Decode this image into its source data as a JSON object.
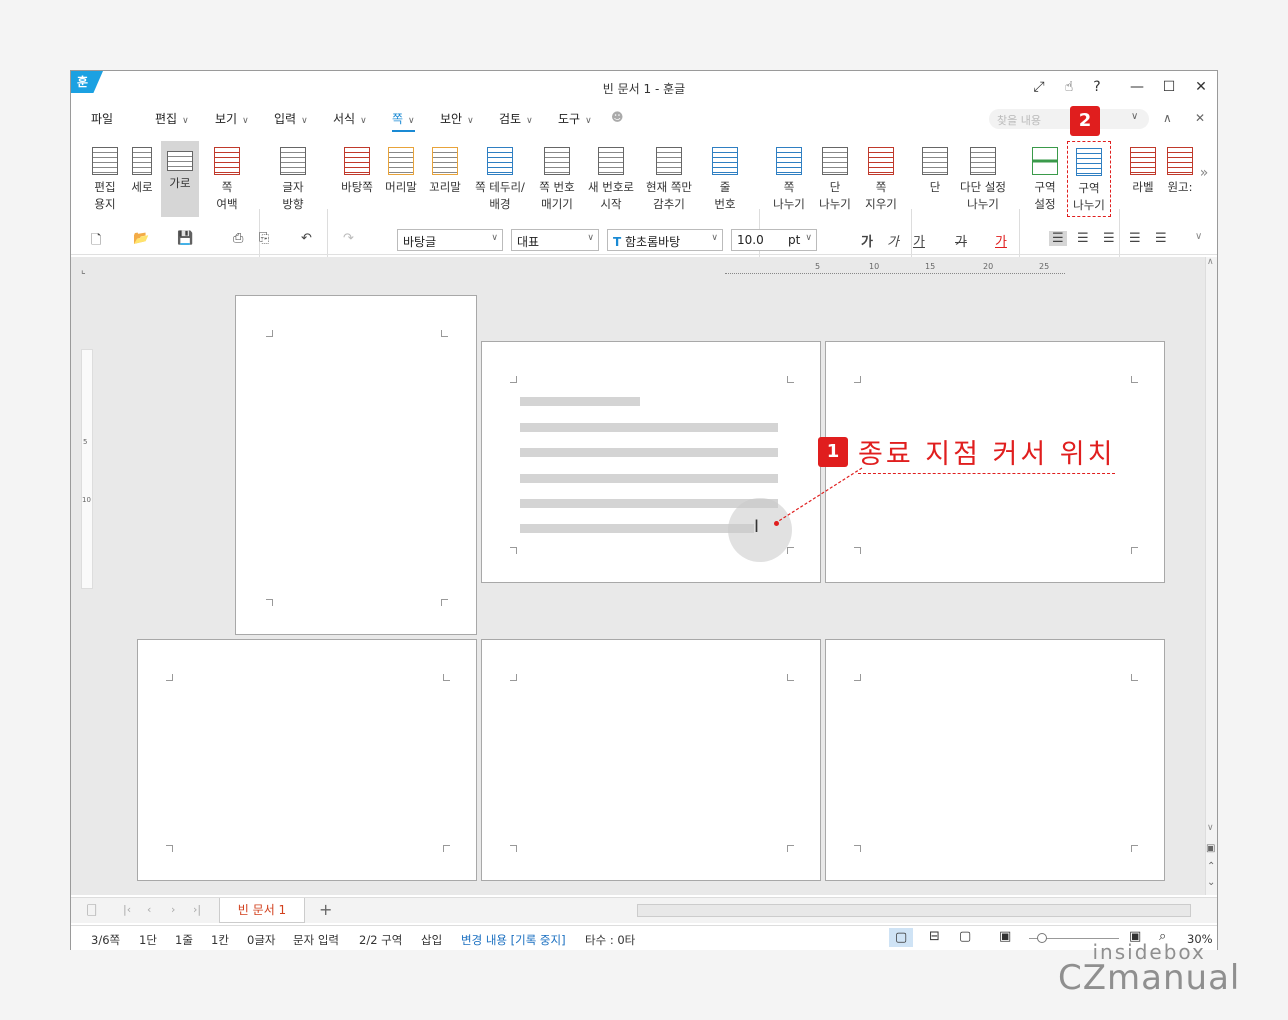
{
  "window": {
    "title": "빈 문서 1 - 훈글",
    "logo": "훈",
    "controls": [
      "fullscreen-icon",
      "hand-icon",
      "help-icon",
      "minimize-icon",
      "maximize-icon",
      "close-icon"
    ]
  },
  "menubar": {
    "items": [
      "파일",
      "편집",
      "보기",
      "입력",
      "서식",
      "쪽",
      "보안",
      "검토",
      "도구"
    ],
    "active": "쪽",
    "search_placeholder": "찾을 내용"
  },
  "ribbon": {
    "items": [
      {
        "label": "편집\n용지"
      },
      {
        "label": "세로"
      },
      {
        "label": "가로"
      },
      {
        "label": "쪽\n여백"
      },
      {
        "label": "글자\n방향"
      },
      {
        "label": "바탕쪽"
      },
      {
        "label": "머리말"
      },
      {
        "label": "꼬리말"
      },
      {
        "label": "쪽 테두리/\n배경"
      },
      {
        "label": "쪽 번호\n매기기"
      },
      {
        "label": "새 번호로\n시작"
      },
      {
        "label": "현재 쪽만\n감추기"
      },
      {
        "label": "줄\n번호"
      },
      {
        "label": "쪽\n나누기"
      },
      {
        "label": "단\n나누기"
      },
      {
        "label": "쪽\n지우기"
      },
      {
        "label": "단"
      },
      {
        "label": "다단 설정\n나누기"
      },
      {
        "label": "구역\n설정"
      },
      {
        "label": "구역\n나누기"
      },
      {
        "label": "라벨"
      },
      {
        "label": "원고:"
      }
    ]
  },
  "format": {
    "style": "바탕글",
    "lang": "대표",
    "font": "함초롬바탕",
    "size": "10.0",
    "unit": "pt",
    "font_icon": "T",
    "bold": "가",
    "italic": "가",
    "underline": "가",
    "strike": "가",
    "color": "가"
  },
  "ruler": {
    "h_ticks": [
      "5",
      "10",
      "15",
      "20",
      "25"
    ],
    "v_ticks": [
      "5",
      "10"
    ]
  },
  "tabs": {
    "doc": "빈 문서 1",
    "add": "+"
  },
  "status": {
    "page": "3/6쪽",
    "col": "1단",
    "line": "1줄",
    "pos": "1칸",
    "chars": "0글자",
    "mode": "문자 입력",
    "section": "2/2 구역",
    "insert": "삽입",
    "track": "변경 내용 [기록 중지]",
    "typing": "타수 : 0타",
    "zoom": "30%"
  },
  "annotations": {
    "badge1": "1",
    "badge2": "2",
    "caption": "종료 지점 커서 위치"
  },
  "watermark": {
    "top": "insidebox",
    "bottom": "CZmanual"
  },
  "colors": {
    "accent": "#1a8ad4",
    "annotation": "#e01e1e"
  }
}
